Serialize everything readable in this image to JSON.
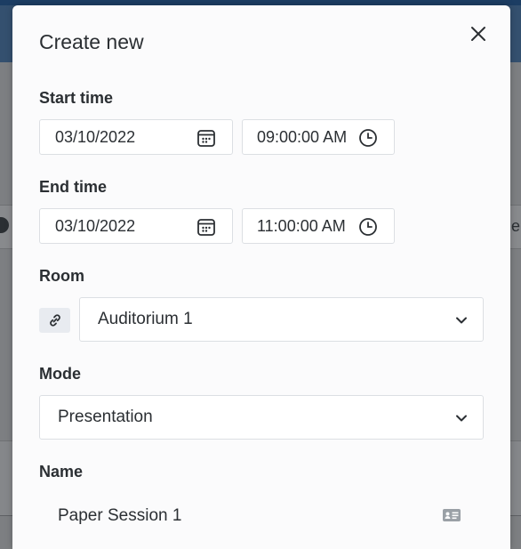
{
  "modal": {
    "title": "Create new",
    "start_time": {
      "label": "Start time",
      "date": "03/10/2022",
      "time": "09:00:00 AM"
    },
    "end_time": {
      "label": "End time",
      "date": "03/10/2022",
      "time": "11:00:00 AM"
    },
    "room": {
      "label": "Room",
      "selected": "Auditorium 1"
    },
    "mode": {
      "label": "Mode",
      "selected": "Presentation"
    },
    "name": {
      "label": "Name",
      "value": "Paper Session 1"
    }
  },
  "icons": {
    "close": "close-icon",
    "calendar": "calendar-icon",
    "clock": "clock-icon",
    "link": "link-icon",
    "chevron": "chevron-down-icon",
    "id_card": "id-card-icon"
  },
  "colors": {
    "accent_topbar": "#1c3d63",
    "modal_bg": "#fbfbfc",
    "text": "#2b2f33",
    "field_border": "#dcdfe3"
  }
}
